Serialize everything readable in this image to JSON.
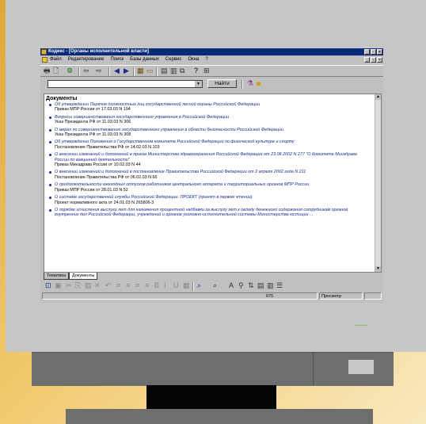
{
  "window": {
    "title": "Кодекс - [Органы исполнительной власти]",
    "title_buttons": [
      "_",
      "▫",
      "×"
    ],
    "mdi_buttons": [
      "_",
      "▫",
      "×"
    ]
  },
  "menu": {
    "items": [
      "Файл",
      "Редактирование",
      "Поиск",
      "Базы данных",
      "Сервис",
      "Окна",
      "?"
    ]
  },
  "search": {
    "input_value": "",
    "find_button": "Найти"
  },
  "document": {
    "heading": "Документы",
    "items": [
      {
        "title": "Об утверждении Перечня должностных лиц государственной лесной охраны Российской Федерации",
        "meta": "Приказ МПР России от 17.03.03 N 194"
      },
      {
        "title": "Вопросы совершенствования государственного управления в Российской Федерации",
        "meta": "Указ Президента РФ от 11.03.03 N 306"
      },
      {
        "title": "О мерах по совершенствованию государственного управления в области безопасности Российской Федерации",
        "meta": "Указ Президента РФ от 11.03.03 N 308"
      },
      {
        "title": "Об утверждении Положения о Государственном комитете Российской Федерации по физической культуре и спорту",
        "meta": "Постановление Правительства РФ от 14.02.03 N 103"
      },
      {
        "title": "О внесении изменений и дополнений в приказ Министерства здравоохранения Российской Федерации от 23.08.2002 N 277 \"О Комитете Минздрава России по вакцинной деятельности\"",
        "meta": "Приказ Минздрава России от 10.02.03 N 44"
      },
      {
        "title": "О внесении изменений и дополнений в постановление Правительства Российской Федерации от 2 апреля 2002 года N 211",
        "meta": "Постановление Правительства РФ от 06.02.03 N 66"
      },
      {
        "title": "О продолжительности ежегодных отпусков работников центрального аппарата и территориальных органов МПР России",
        "meta": "Приказ МПР России от 28.01.03 N 52"
      },
      {
        "title": "О системе государственной службы Российской Федерации. ПРОЕКТ (принят в первом чтении)",
        "meta": "Проект нормативного акта от 24.01.03 N 265806-3"
      },
      {
        "title": "О порядке исчисления выслуги лет для назначения процентной надбавки за выслугу лет к окладу денежного содержания сотрудникам органов внутренних дел Российской Федерации, учреждений и органов уголовно-исполнительной системы Министерства юстиции ...",
        "meta": ""
      }
    ]
  },
  "tabs": [
    "Тематика",
    "Документы"
  ],
  "status": {
    "count": "675",
    "mode": "Просмотр"
  },
  "icons": {
    "app": "kodeks-app-icon",
    "print": "printer-icon",
    "preview": "print-preview-icon",
    "back": "back-arrow-icon",
    "forward": "forward-arrow-icon"
  }
}
